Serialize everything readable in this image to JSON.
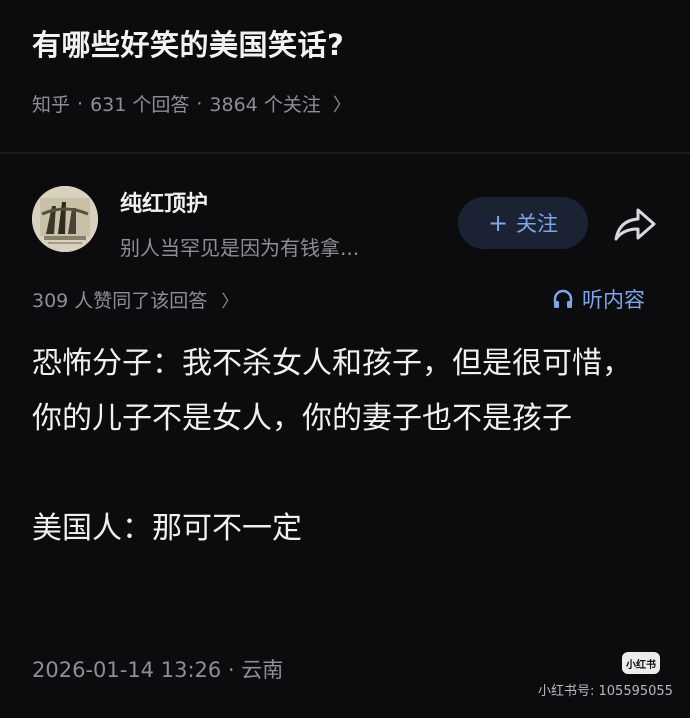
{
  "question": {
    "title": "有哪些好笑的美国笑话?",
    "source": "知乎",
    "separator": "·",
    "answers_count": "631 个回答",
    "followers_count": "3864 个关注",
    "chevron_icon": "chevron-right-icon"
  },
  "author": {
    "name": "纯红顶护",
    "bio": "别人当罕见是因为有钱拿...",
    "avatar_icon": "avatar-image",
    "follow_label": "关注",
    "follow_prefix": "+",
    "share_icon": "share-icon"
  },
  "answer": {
    "votes": "309 人赞同了该回答",
    "listen_label": "听内容",
    "listen_icon": "headphones-icon",
    "paragraphs": [
      "恐怖分子：我不杀女人和孩子，但是很可惜，你的儿子不是女人，你的妻子也不是孩子",
      "美国人：那可不一定"
    ],
    "timestamp": "2026-01-14 13:26 · 云南"
  },
  "watermark": {
    "logo_text": "小红书",
    "id_text": "小红书号: 105595055"
  },
  "colors": {
    "background": "#0c0c0e",
    "primary_text": "#f0f0f0",
    "secondary_text": "#8e8e93",
    "accent": "#7ea6ea",
    "follow_button_bg": "#1a2233"
  }
}
